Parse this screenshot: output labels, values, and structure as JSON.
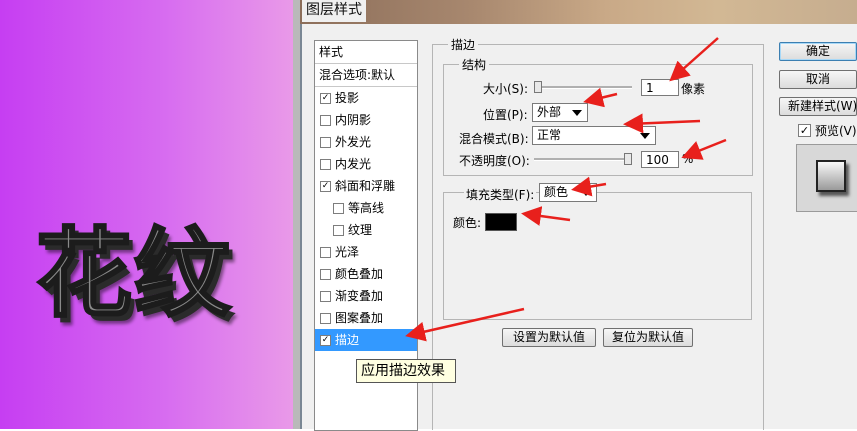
{
  "window": {
    "title": "图层样式"
  },
  "canvas": {
    "art_text": "花纹"
  },
  "styles_panel": {
    "header": "样式",
    "blend_options": "混合选项:默认",
    "items": [
      {
        "label": "投影",
        "checked": true,
        "indent": false,
        "selected": false
      },
      {
        "label": "内阴影",
        "checked": false,
        "indent": false,
        "selected": false
      },
      {
        "label": "外发光",
        "checked": false,
        "indent": false,
        "selected": false
      },
      {
        "label": "内发光",
        "checked": false,
        "indent": false,
        "selected": false
      },
      {
        "label": "斜面和浮雕",
        "checked": true,
        "indent": false,
        "selected": false
      },
      {
        "label": "等高线",
        "checked": false,
        "indent": true,
        "selected": false
      },
      {
        "label": "纹理",
        "checked": false,
        "indent": true,
        "selected": false
      },
      {
        "label": "光泽",
        "checked": false,
        "indent": false,
        "selected": false
      },
      {
        "label": "颜色叠加",
        "checked": false,
        "indent": false,
        "selected": false
      },
      {
        "label": "渐变叠加",
        "checked": false,
        "indent": false,
        "selected": false
      },
      {
        "label": "图案叠加",
        "checked": false,
        "indent": false,
        "selected": false
      },
      {
        "label": "描边",
        "checked": true,
        "indent": false,
        "selected": true
      }
    ],
    "tooltip": "应用描边效果"
  },
  "stroke": {
    "group_title": "描边",
    "structure_title": "结构",
    "size_label": "大小(S):",
    "size_value": "1",
    "size_unit": "像素",
    "position_label": "位置(P):",
    "position_value": "外部",
    "blend_label": "混合模式(B):",
    "blend_value": "正常",
    "opacity_label": "不透明度(O):",
    "opacity_value": "100",
    "opacity_unit": "%",
    "size_fraction": 0.0,
    "opacity_fraction": 1.0,
    "fill_type_label": "填充类型(F):",
    "fill_type_value": "颜色",
    "color_label": "颜色:",
    "color_value": "#000000",
    "set_default_button": "设置为默认值",
    "reset_default_button": "复位为默认值"
  },
  "right_buttons": {
    "ok": "确定",
    "cancel": "取消",
    "new_style": "新建样式(W)...",
    "preview_label": "预览(V)",
    "preview_checked": true
  },
  "colors": {
    "annotation_arrow": "#e8201c",
    "selection": "#3399ff"
  }
}
